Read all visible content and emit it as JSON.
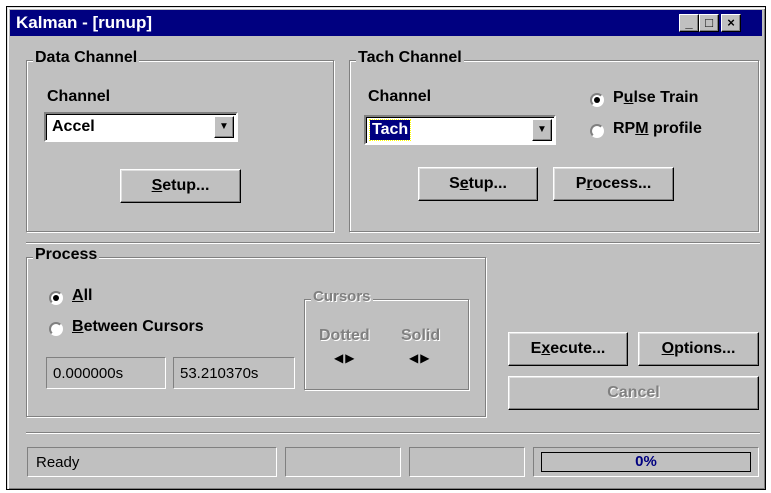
{
  "window": {
    "title": "Kalman - [runup]",
    "minimize": "_",
    "maximize": "□",
    "close": "×"
  },
  "data_channel": {
    "group_label": "Data Channel",
    "channel_label": "Channel",
    "channel_value": "Accel",
    "setup_pre": "",
    "setup_key": "S",
    "setup_post": "etup..."
  },
  "tach_channel": {
    "group_label": "Tach Channel",
    "channel_label": "Channel",
    "channel_value": "Tach",
    "radio_pulse_pre": "P",
    "radio_pulse_key": "u",
    "radio_pulse_post": "lse Train",
    "radio_rpm_pre": "RP",
    "radio_rpm_key": "M",
    "radio_rpm_post": " profile",
    "selected_mode": "Pulse Train",
    "setup_pre": "S",
    "setup_key": "e",
    "setup_post": "tup...",
    "process_pre": "P",
    "process_key": "r",
    "process_post": "ocess..."
  },
  "process": {
    "group_label": "Process",
    "radio_all_pre": "",
    "radio_all_key": "A",
    "radio_all_post": "ll",
    "radio_between_pre": "",
    "radio_between_key": "B",
    "radio_between_post": "etween Cursors",
    "selected": "All",
    "start_value": "0.000000s",
    "end_value": "53.210370s",
    "cursors": {
      "label": "Cursors",
      "dotted_label": "Dotted",
      "solid_label": "Solid",
      "spin_glyph": "◀▶"
    }
  },
  "buttons": {
    "execute_pre": "E",
    "execute_key": "x",
    "execute_post": "ecute...",
    "options_pre": "",
    "options_key": "O",
    "options_post": "ptions...",
    "cancel": "Cancel"
  },
  "status_bar": {
    "status_text": "Ready",
    "progress_text": "0%",
    "progress_value": 0
  },
  "colors": {
    "title_bar": "#000080",
    "face": "#c0c0c0",
    "highlight": "#000080"
  }
}
